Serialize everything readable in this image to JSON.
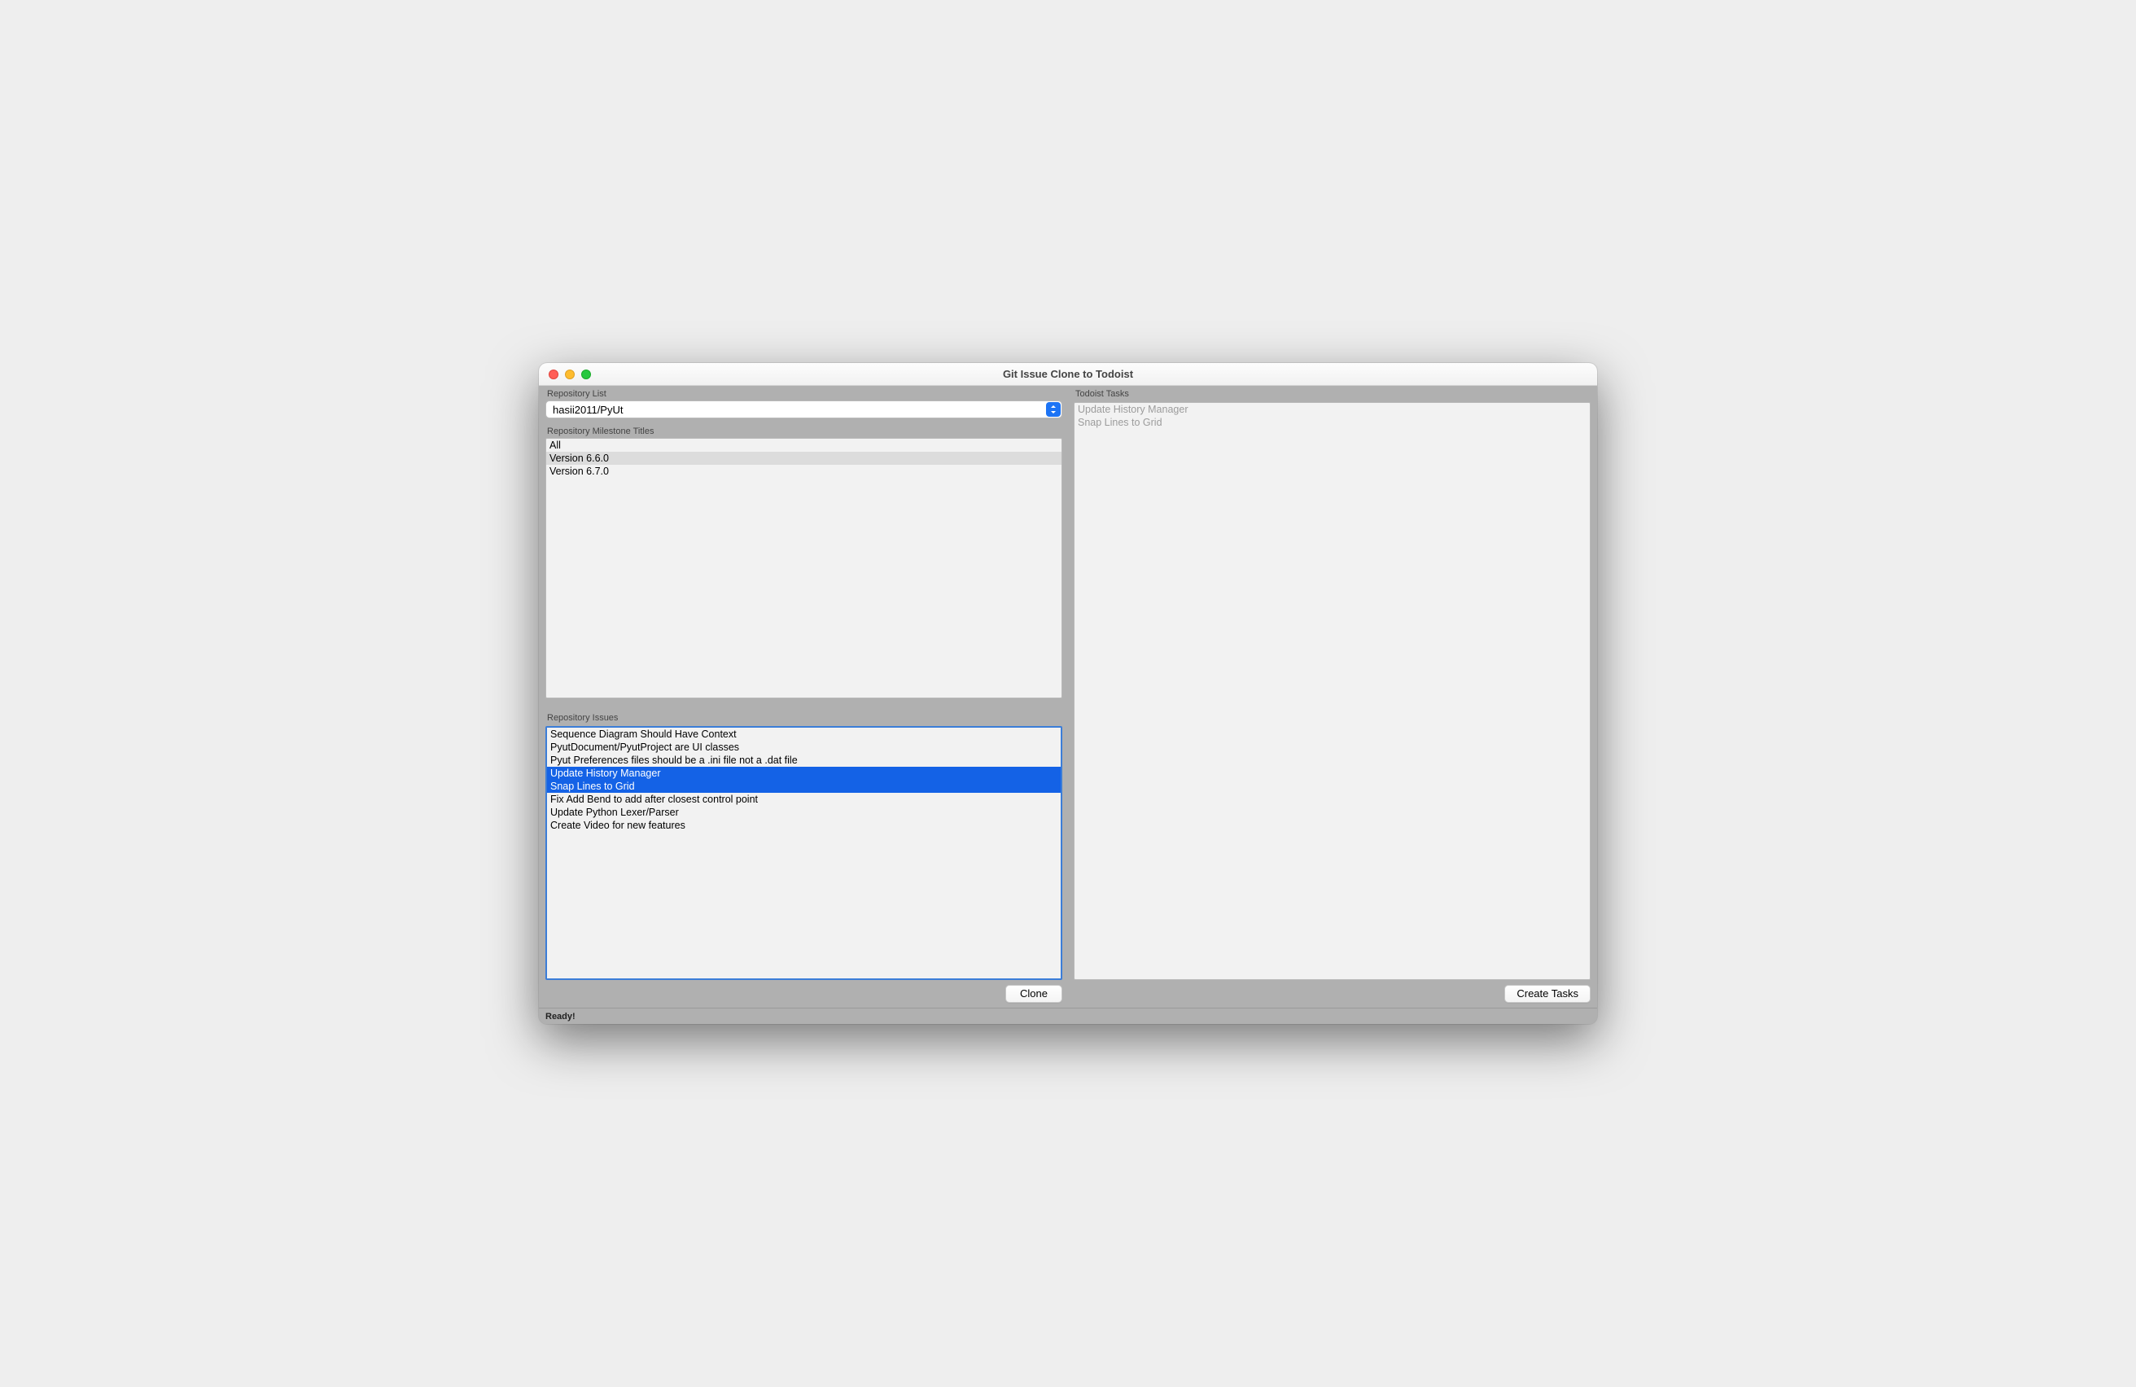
{
  "window": {
    "title": "Git Issue Clone to Todoist"
  },
  "left": {
    "repo_section_label": "Repository List",
    "repo_combo_value": "hasii2011/PyUt",
    "milestone_section_label": "Repository Milestone Titles",
    "milestones": [
      {
        "label": "All",
        "selected": false
      },
      {
        "label": "Version 6.6.0",
        "selected": true
      },
      {
        "label": "Version  6.7.0",
        "selected": false
      }
    ],
    "issues_section_label": "Repository Issues",
    "issues": [
      {
        "label": "Sequence Diagram Should Have Context",
        "selected": false
      },
      {
        "label": "PyutDocument/PyutProject are UI classes",
        "selected": false
      },
      {
        "label": "Pyut Preferences files should be a .ini file not a .dat file",
        "selected": false
      },
      {
        "label": "Update History Manager",
        "selected": true
      },
      {
        "label": "Snap Lines to Grid",
        "selected": true
      },
      {
        "label": "Fix Add Bend to add after closest control point",
        "selected": false
      },
      {
        "label": "Update Python Lexer/Parser",
        "selected": false
      },
      {
        "label": "Create Video for new features",
        "selected": false
      }
    ],
    "clone_button": "Clone"
  },
  "right": {
    "tasks_section_label": "Todoist Tasks",
    "tasks": [
      {
        "label": "Update History Manager"
      },
      {
        "label": "Snap Lines to Grid"
      }
    ],
    "create_button": "Create Tasks"
  },
  "status": {
    "text": "Ready!"
  },
  "colors": {
    "selection_blue": "#1462e6",
    "selection_gray": "#dcdcdc",
    "combo_endcap": "#1d74f5"
  }
}
